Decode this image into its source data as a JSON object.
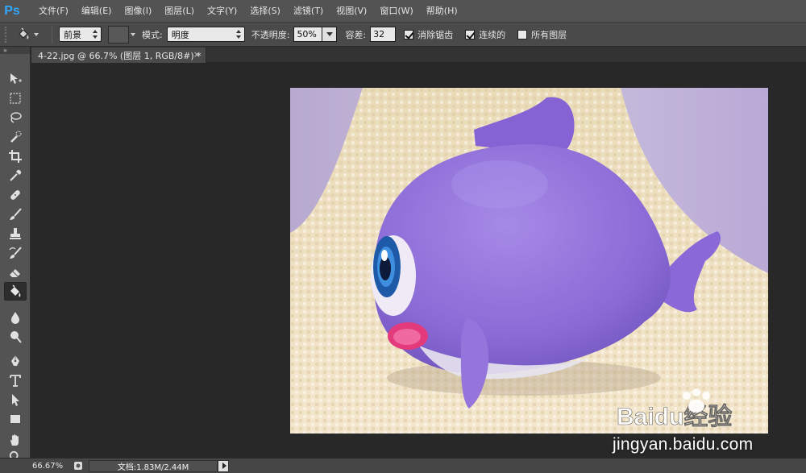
{
  "app": {
    "logo": "Ps",
    "accent": "#31a8ff"
  },
  "menu": [
    "文件(F)",
    "编辑(E)",
    "图像(I)",
    "图层(L)",
    "文字(Y)",
    "选择(S)",
    "滤镜(T)",
    "视图(V)",
    "窗口(W)",
    "帮助(H)"
  ],
  "options": {
    "tool_icon": "paint-bucket-icon",
    "fill_source": "前景",
    "mode_label": "模式:",
    "mode_value": "明度",
    "opacity_label": "不透明度:",
    "opacity_value": "50%",
    "tolerance_label": "容差:",
    "tolerance_value": "32",
    "antialias_label": "消除锯齿",
    "antialias_checked": true,
    "contiguous_label": "连续的",
    "contiguous_checked": true,
    "all_layers_label": "所有图层",
    "all_layers_checked": false
  },
  "tools": [
    "move-tool-icon",
    "marquee-tool-icon",
    "lasso-tool-icon",
    "quick-selection-tool-icon",
    "crop-tool-icon",
    "eyedropper-tool-icon",
    "healing-brush-tool-icon",
    "brush-tool-icon",
    "clone-stamp-tool-icon",
    "history-brush-tool-icon",
    "eraser-tool-icon",
    "paint-bucket-tool-icon",
    "blur-tool-icon",
    "dodge-tool-icon",
    "pen-tool-icon",
    "type-tool-icon",
    "path-selection-tool-icon",
    "rectangle-tool-icon",
    "hand-tool-icon",
    "zoom-tool-icon"
  ],
  "active_tool": "paint-bucket-tool-icon",
  "document": {
    "tab_title": "4-22.jpg @ 66.7% (图层 1, RGB/8#) *",
    "close_glyph": "×"
  },
  "status": {
    "zoom": "66.67%",
    "doc_info": "文档:1.83M/2.44M"
  },
  "watermark": {
    "logo_text": "Baidu经验",
    "url": "jingyan.baidu.com"
  }
}
